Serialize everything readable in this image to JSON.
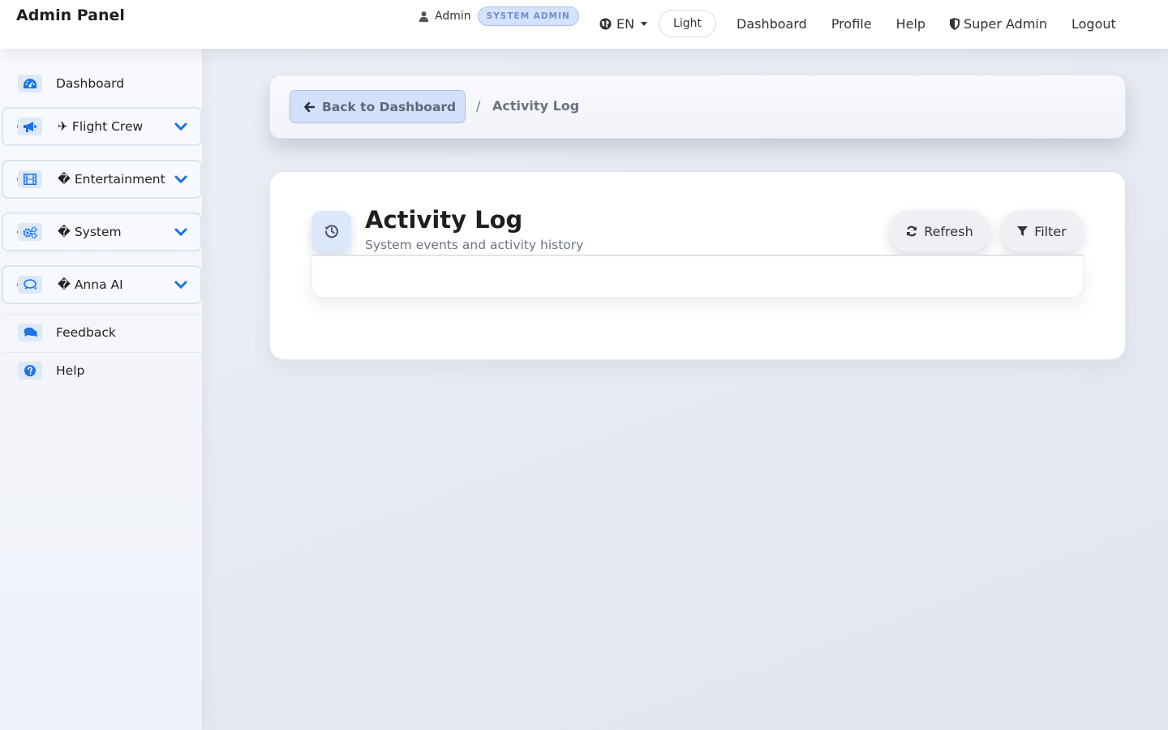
{
  "brand": "Admin Panel",
  "user": {
    "name": "Admin",
    "role_badge": "SYSTEM ADMIN"
  },
  "language": "EN",
  "theme_toggle": "Light",
  "nav": {
    "dashboard": "Dashboard",
    "profile": "Profile",
    "help": "Help",
    "super_admin": "Super Admin",
    "logout": "Logout"
  },
  "sidebar": {
    "dashboard": "Dashboard",
    "groups": [
      {
        "label": "✈ Flight Crew",
        "icon": "megaphone-icon"
      },
      {
        "label": "� Entertainment",
        "icon": "film-icon"
      },
      {
        "label": "� System",
        "icon": "cogs-icon"
      },
      {
        "label": "� Anna AI",
        "icon": "chat-icon"
      }
    ],
    "feedback": "Feedback",
    "help": "Help"
  },
  "breadcrumb": {
    "back_label": "Back to Dashboard",
    "separator": "/",
    "current": "Activity Log"
  },
  "page": {
    "title": "Activity Log",
    "subtitle": "System events and activity history",
    "refresh_label": "Refresh",
    "filter_label": "Filter"
  },
  "colors": {
    "accent": "#1a73e8",
    "badge_bg": "#d6e2fb",
    "badge_text": "#6b8fd6"
  }
}
